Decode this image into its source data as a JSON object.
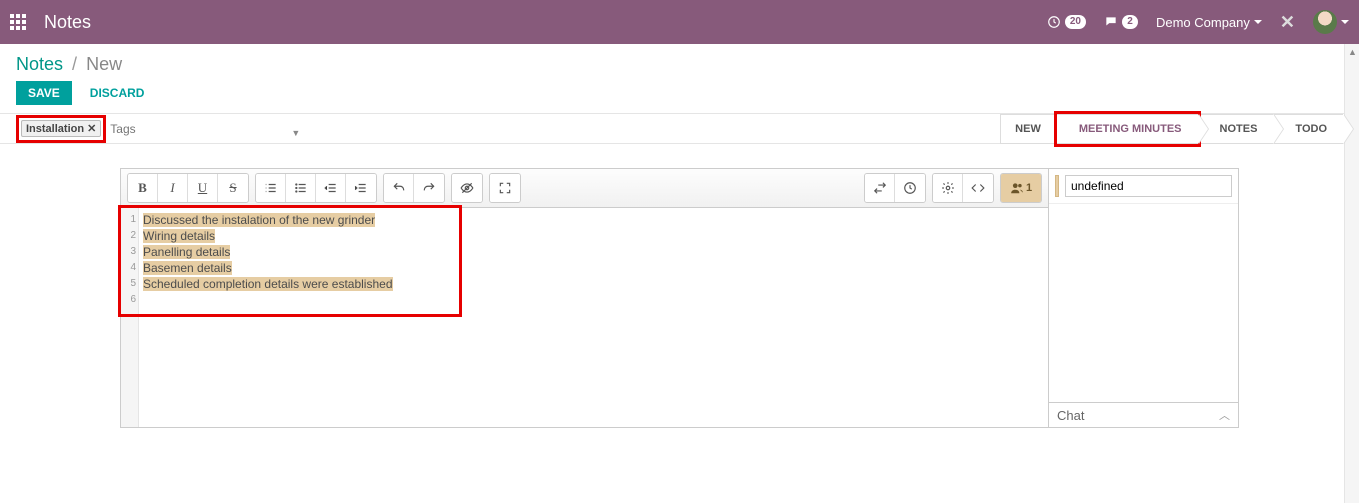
{
  "navbar": {
    "app_title": "Notes",
    "activity_count": "20",
    "message_count": "2",
    "company": "Demo Company"
  },
  "breadcrumb": {
    "root": "Notes",
    "current": "New"
  },
  "buttons": {
    "save": "SAVE",
    "discard": "DISCARD"
  },
  "tags": {
    "chip": "Installation",
    "placeholder": "Tags"
  },
  "stages": {
    "new": "NEW",
    "meeting": "MEETING MINUTES",
    "notes": "NOTES",
    "todo": "TODO"
  },
  "editor": {
    "lines": {
      "l1": "Discussed the instalation of the new grinder",
      "l2": "Wiring details",
      "l3": "Panelling details",
      "l4": "Basemen details",
      "l5": "Scheduled completion details were established"
    },
    "gutter": {
      "n1": "1",
      "n2": "2",
      "n3": "3",
      "n4": "4",
      "n5": "5",
      "n6": "6"
    },
    "collab_count": "1"
  },
  "side": {
    "author_label": "undefined",
    "chat_title": "Chat"
  }
}
